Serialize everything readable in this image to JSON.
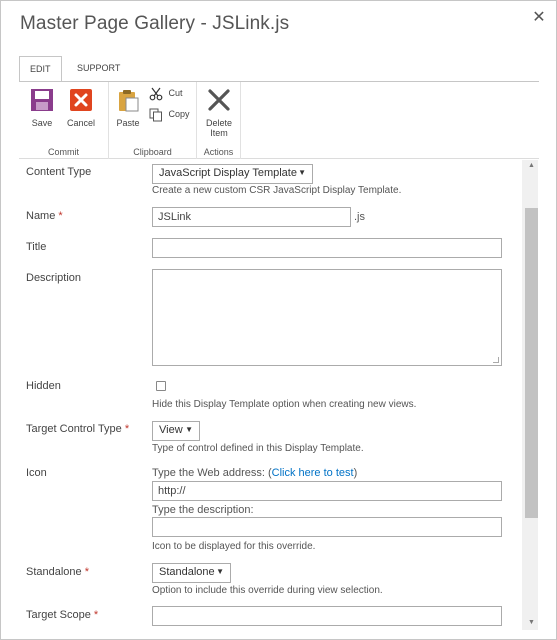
{
  "dialog": {
    "title": "Master Page Gallery - JSLink.js",
    "close_glyph": "✕"
  },
  "ribbon": {
    "tabs": [
      {
        "label": "EDIT",
        "active": true
      },
      {
        "label": "SUPPORT",
        "active": false
      }
    ],
    "groups": {
      "commit": {
        "label": "Commit",
        "save_label": "Save",
        "cancel_label": "Cancel"
      },
      "clipboard": {
        "label": "Clipboard",
        "paste_label": "Paste",
        "cut_label": "Cut",
        "copy_label": "Copy"
      },
      "actions": {
        "label": "Actions",
        "delete_label_line1": "Delete",
        "delete_label_line2": "Item"
      }
    },
    "colors": {
      "save_icon": "#8a3c8c",
      "cancel_icon": "#e0451f",
      "delete_icon": "#555555"
    }
  },
  "form": {
    "content_type": {
      "label": "Content Type",
      "value": "JavaScript Display Template",
      "hint": "Create a new custom CSR JavaScript Display Template."
    },
    "name": {
      "label": "Name",
      "required_mark": "*",
      "value": "JSLink",
      "suffix": ".js"
    },
    "title": {
      "label": "Title",
      "value": ""
    },
    "description": {
      "label": "Description",
      "value": ""
    },
    "hidden": {
      "label": "Hidden",
      "checked": false,
      "hint": "Hide this Display Template option when creating new views."
    },
    "target_control_type": {
      "label": "Target Control Type",
      "required_mark": "*",
      "value": "View",
      "hint": "Type of control defined in this Display Template."
    },
    "icon": {
      "label": "Icon",
      "address_prompt": "Type the Web address: (",
      "address_link": "Click here to test",
      "address_prompt_end": ")",
      "url_value": "http://",
      "description_prompt": "Type the description:",
      "description_value": "",
      "hint": "Icon to be displayed for this override."
    },
    "standalone": {
      "label": "Standalone",
      "required_mark": "*",
      "value": "Standalone",
      "hint": "Option to include this override during view selection."
    },
    "target_scope": {
      "label": "Target Scope",
      "required_mark": "*",
      "value": ""
    }
  },
  "dropdown_arrow": "▼"
}
